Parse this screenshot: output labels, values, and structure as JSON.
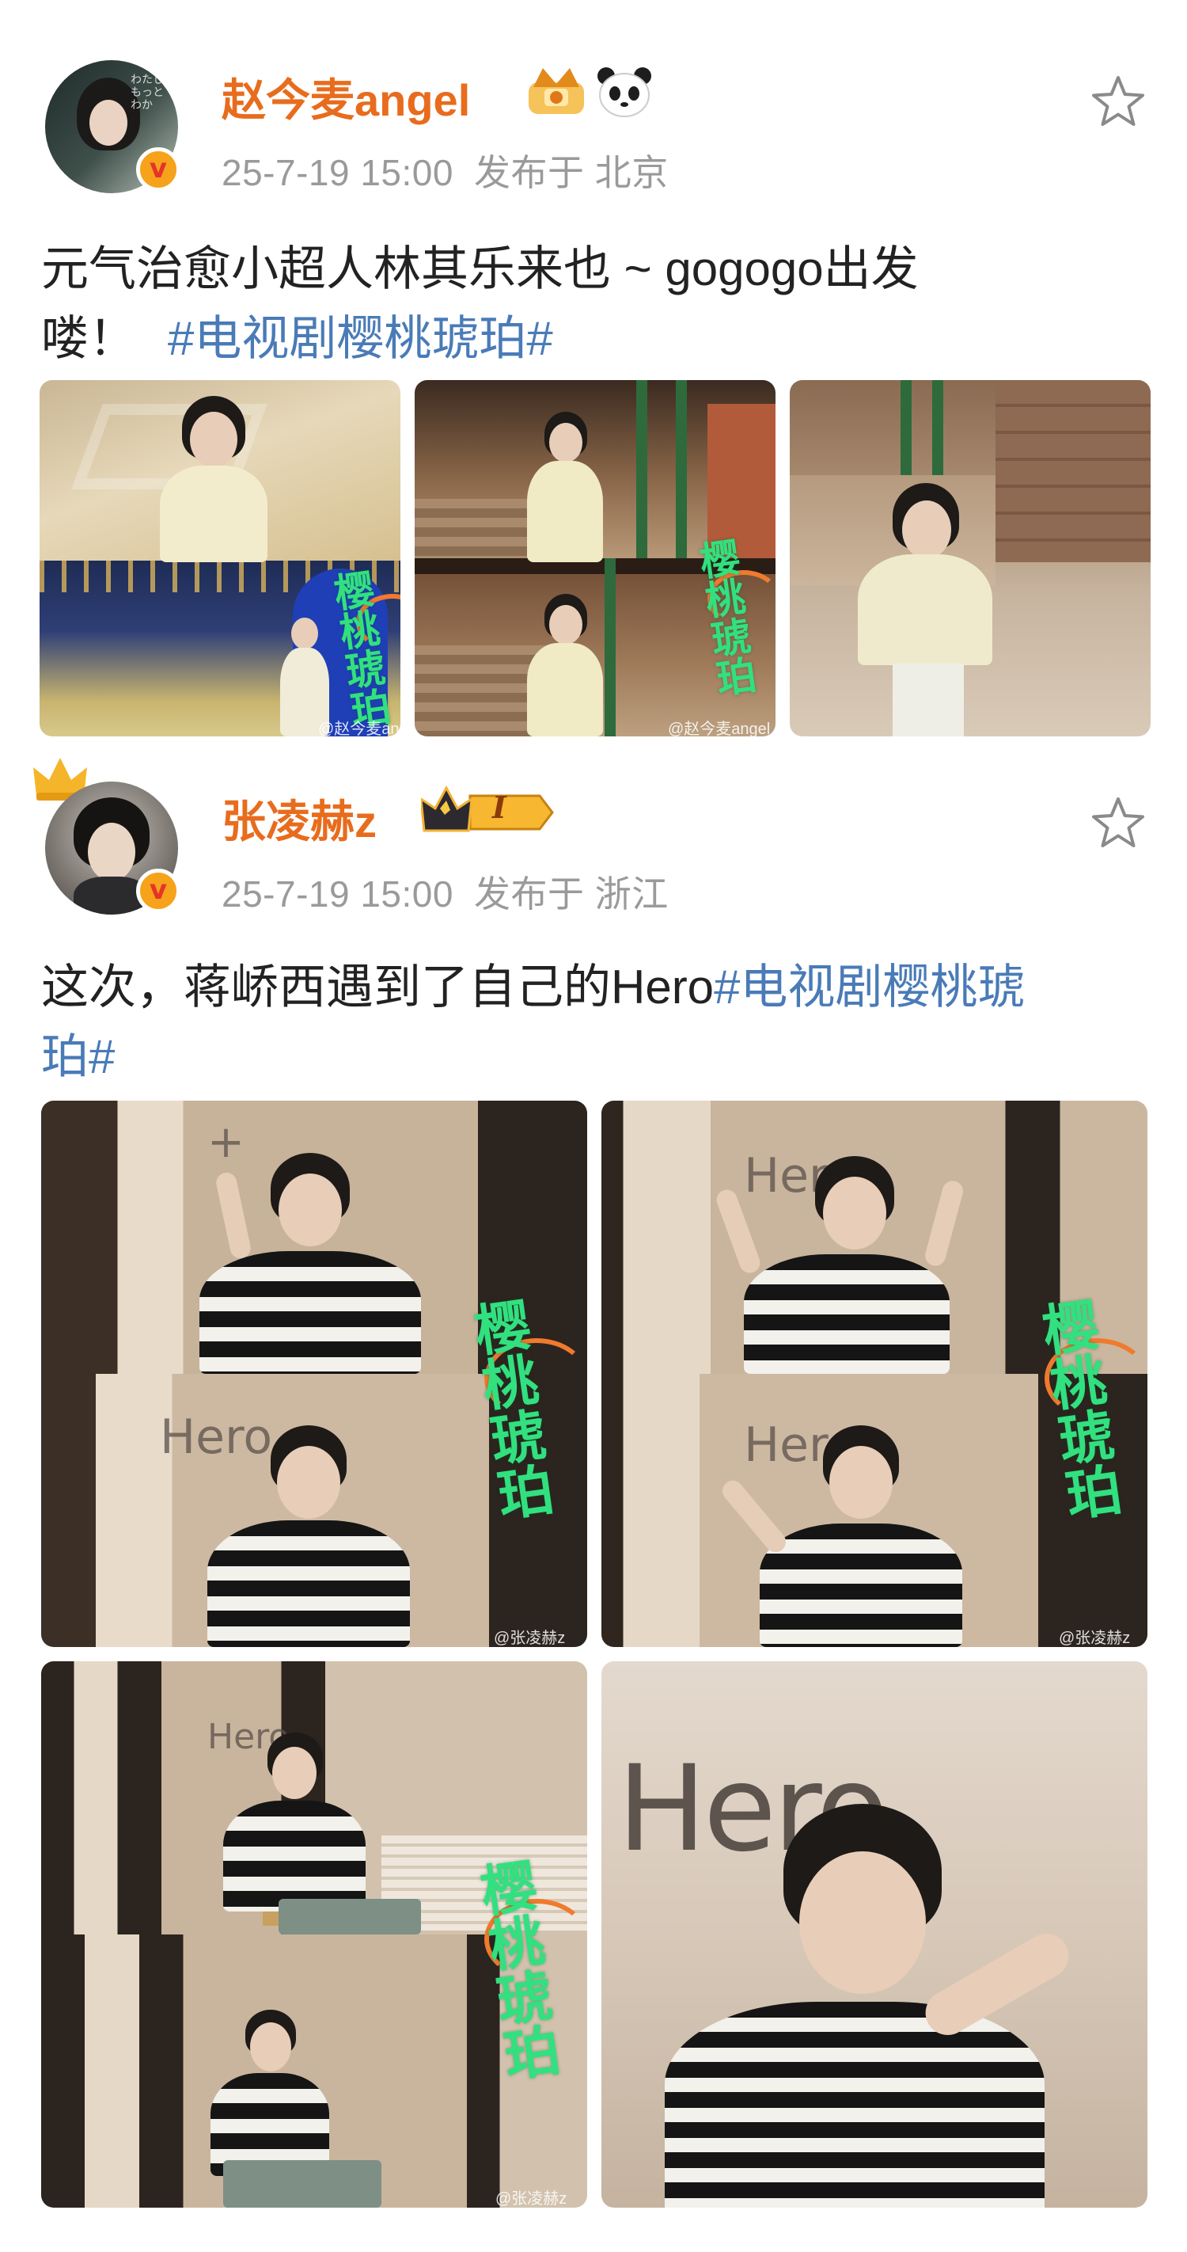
{
  "posts": [
    {
      "username": "赵今麦angel",
      "badges": [
        "crown-badge-icon",
        "panda-icon"
      ],
      "date": "25-7-19 15:00",
      "location": "发布于 北京",
      "text_line1": "元气治愈小超人林其乐来也 ~ gogogo出发",
      "text_line2_plain": "喽！",
      "hashtag": "#电视剧樱桃琥珀#",
      "logo_text": "樱桃琥珀",
      "watermark": "@赵今麦angel",
      "colors": {
        "username": "#e86c1d",
        "hashtag": "#4a7bb7"
      }
    },
    {
      "username": "张凌赫z",
      "badges": [
        "crown-level-badge-icon"
      ],
      "level_badge": "I",
      "date": "25-7-19 15:00",
      "location": "发布于 浙江",
      "text_line1_plain": "这次，蒋峤西遇到了自己的Hero",
      "hashtag_line1": "#电视剧樱桃琥",
      "hashtag_line2": "珀#",
      "scrawl": "Hero",
      "logo_text": "樱桃琥珀",
      "watermark": "@张凌赫z"
    }
  ],
  "icons": {
    "favorite": "star-outline-icon",
    "verified": "verified-v-icon"
  }
}
